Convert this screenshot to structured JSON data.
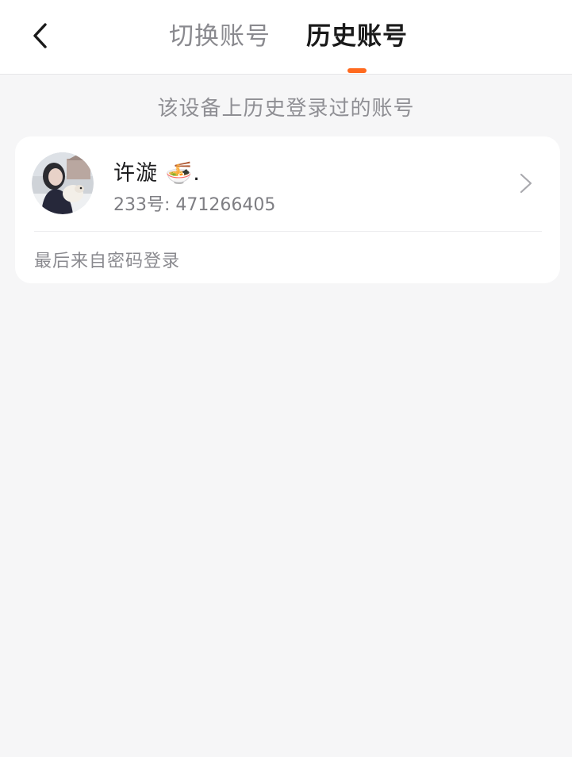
{
  "header": {
    "back_icon": "chevron-left-icon",
    "tabs": [
      {
        "label": "切换账号",
        "active": false
      },
      {
        "label": "历史账号",
        "active": true
      }
    ],
    "accent_color": "#ff6a1f"
  },
  "subtitle": "该设备上历史登录过的账号",
  "accounts": [
    {
      "name": "许漩 🍜.",
      "id_text": "233号: 471266405",
      "last_login": "最后来自密码登录",
      "avatar_icon": "user-photo",
      "arrow_icon": "chevron-right-icon"
    }
  ]
}
